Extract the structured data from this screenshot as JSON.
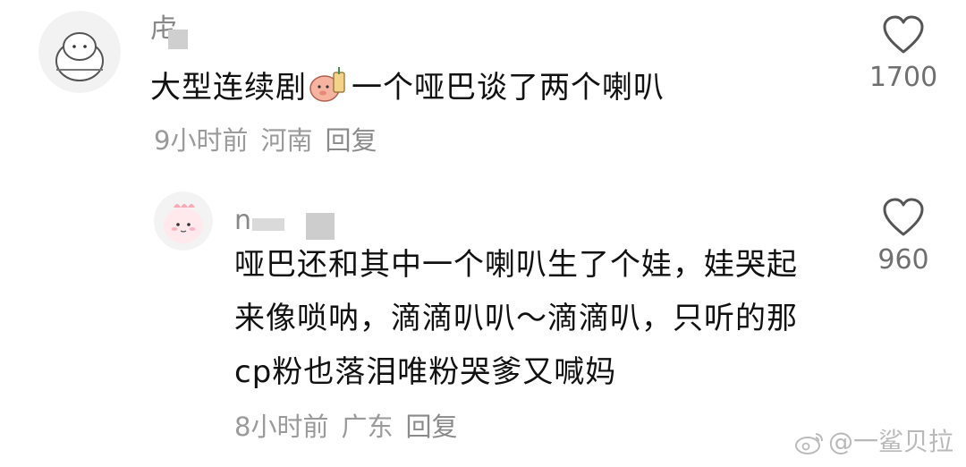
{
  "comments": [
    {
      "username": "⾌",
      "text_before_emoji": "大型连续剧",
      "emoji": "pig-bubble-tea-emoji",
      "text_after_emoji": "一个哑巴谈了两个喇叭",
      "time": "9小时前",
      "location": "河南",
      "reply_label": "回复",
      "likes": "1700"
    },
    {
      "username": "n",
      "lines": [
        "哑巴还和其中一个喇叭生了个娃，娃哭起",
        "来像唢呐，滴滴叭叭～滴滴叭，只听的那",
        "cp粉也落泪唯粉哭爹又喊妈"
      ],
      "time": "8小时前",
      "location": "广东",
      "reply_label": "回复",
      "likes": "960"
    }
  ],
  "watermark": "@一鲨贝拉",
  "icons": {
    "like": "heart-outline-icon",
    "watermark_logo": "weibo-icon"
  },
  "colors": {
    "text": "#111111",
    "meta": "#9a9a9a",
    "like_count": "#6f6f6f"
  }
}
